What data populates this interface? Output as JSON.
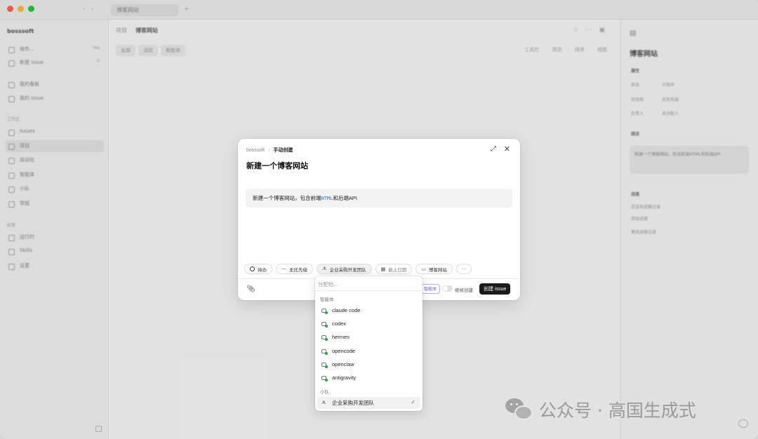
{
  "background": {
    "tab_label": "博客网站",
    "workspace": "bosssoft",
    "sidebar": {
      "top_items": [
        {
          "label": "收件...",
          "count": "Yes"
        },
        {
          "label": "新建 issue",
          "count": "0"
        }
      ],
      "mid_items": [
        {
          "label": "我的看板"
        },
        {
          "label": "我的 issue"
        }
      ],
      "section1": "工作区",
      "section1_items": [
        {
          "label": "Issues"
        },
        {
          "label": "项目"
        },
        {
          "label": "自动化"
        },
        {
          "label": "智能体"
        },
        {
          "label": "小队"
        },
        {
          "label": "常规"
        }
      ],
      "section2": "配置",
      "section2_items": [
        {
          "label": "运行时"
        },
        {
          "label": "Skills"
        },
        {
          "label": "设置"
        }
      ]
    },
    "header": {
      "crumb": "项目",
      "title": "博客网站"
    },
    "tabs": [
      "全部",
      "活跃",
      "智能体"
    ],
    "tools": "工具栏 筛选 排序 视图",
    "right_panel": {
      "title": "博客网站",
      "section_props": "属性",
      "rows": [
        {
          "k": "状态",
          "v": "计划中"
        },
        {
          "k": "优先级",
          "v": "无优先级"
        },
        {
          "k": "负责人",
          "v": "未分配人"
        }
      ],
      "section_desc": "描述",
      "desc": "新建一个博客网站，包含前端HTML和后端API",
      "section_issues": "进展",
      "issues": [
        "还没有进展记录",
        "添加进展",
        "更改进展记录"
      ]
    }
  },
  "modal": {
    "breadcrumb_workspace": "bosssoft",
    "breadcrumb_sep": "›",
    "breadcrumb_mode": "手动创建",
    "title": "新建一个博客网站",
    "desc_before": "新建一个博客网站，包含前端",
    "desc_code": "HTML",
    "desc_after": "和后端API",
    "chips": {
      "status": "待办",
      "priority": "无优先级",
      "assignee": "企业采购开发团队",
      "due": "截止日期",
      "project": "博客网站",
      "more": "···"
    },
    "agent_pill": "智能体",
    "toggle_label": "继续创建",
    "create_label": "创建 issue"
  },
  "dropdown": {
    "search_placeholder": "分配给...",
    "section_agents": "智能体",
    "agents": [
      "claude code",
      "codex",
      "hermes",
      "opencode",
      "openclaw",
      "antigravity"
    ],
    "section_teams": "小队",
    "teams": [
      "企业采购开发团队"
    ]
  },
  "watermark": {
    "text": "公众号 · 高国生成式"
  },
  "colors": {
    "accent_code": "#3a6fd6",
    "agent_online": "#22a04a",
    "primary_button": "#1a1a1a"
  }
}
